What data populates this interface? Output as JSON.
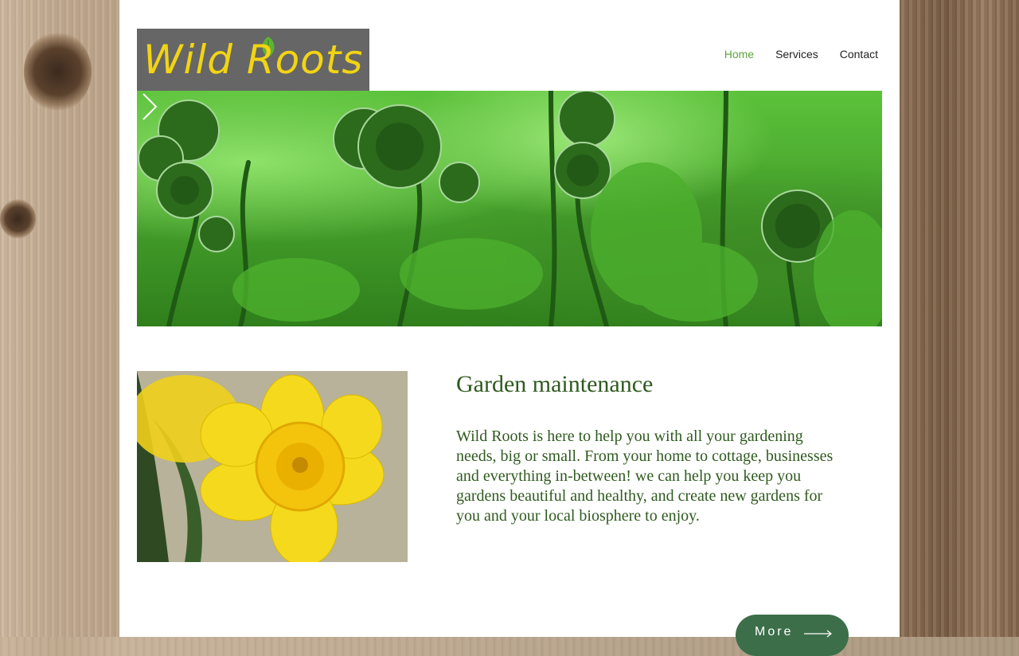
{
  "brand": {
    "name": "Wild Roots"
  },
  "nav": {
    "items": [
      {
        "label": "Home",
        "active": true
      },
      {
        "label": "Services",
        "active": false
      },
      {
        "label": "Contact",
        "active": false
      }
    ]
  },
  "hero": {
    "next_icon": "chevron-right-icon"
  },
  "section": {
    "title": "Garden maintenance",
    "body": "Wild Roots is here to help you with all your gardening needs, big or small.  From your home to cottage, businesses and everything in-between!  we can help you keep you gardens beautiful and healthy, and create new gardens for you and your local biosphere to enjoy.",
    "more_label": "More"
  },
  "colors": {
    "accent": "#5aa33e",
    "heading": "#2f5a1f",
    "logo_bg": "#666666",
    "logo_text": "#f2d413",
    "button": "#3c6e4a"
  }
}
